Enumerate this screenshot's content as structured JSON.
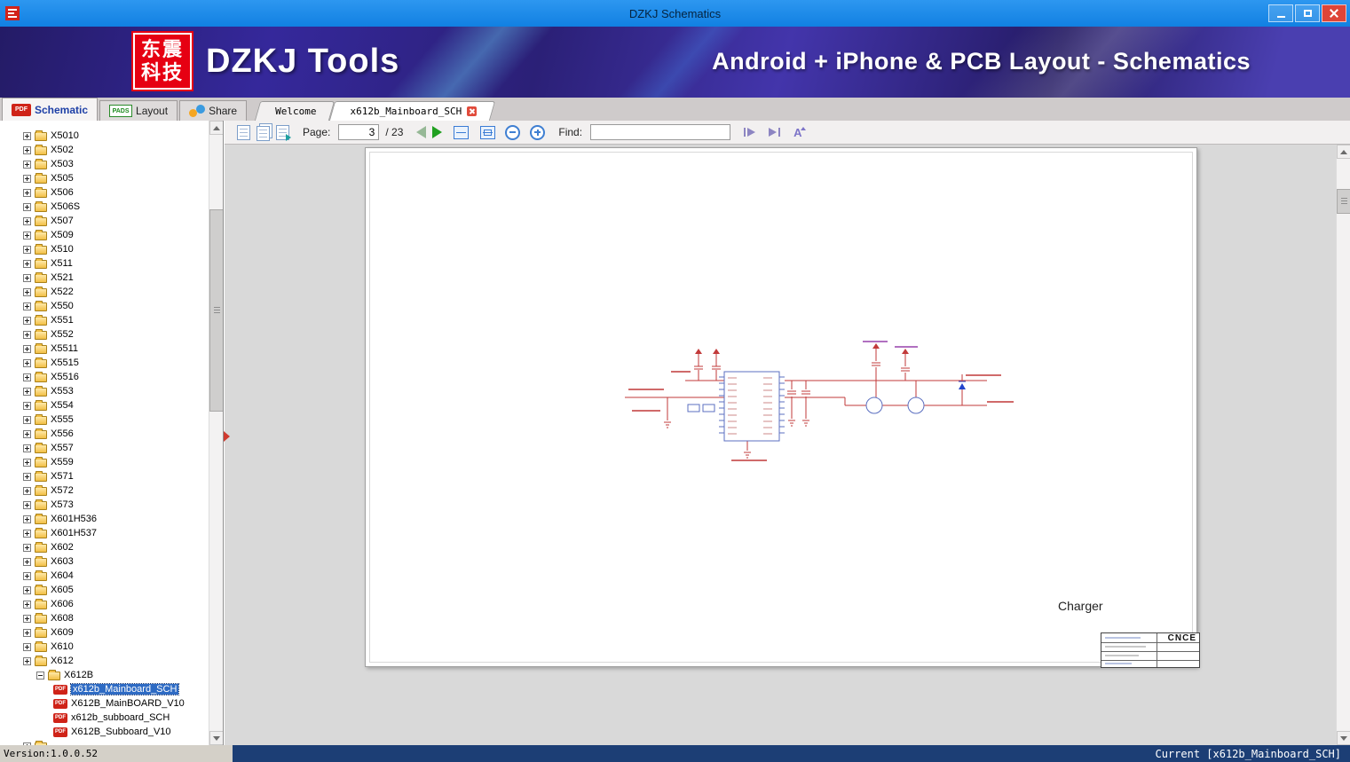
{
  "window": {
    "title": "DZKJ Schematics"
  },
  "banner": {
    "logo_top": "东震",
    "logo_bottom": "科技",
    "app_name": "DZKJ Tools",
    "tagline": "Android + iPhone & PCB Layout - Schematics"
  },
  "mode_tabs": [
    {
      "label": "Schematic",
      "icon_text": "PDF",
      "active": true
    },
    {
      "label": "Layout",
      "icon_text": "PADS",
      "active": false
    },
    {
      "label": "Share",
      "active": false
    }
  ],
  "doc_tabs": [
    {
      "label": "Welcome",
      "active": false
    },
    {
      "label": "x612b_Mainboard_SCH",
      "active": true,
      "closable": true
    }
  ],
  "toolbar": {
    "page_label": "Page:",
    "page_value": "3",
    "page_total": "/ 23",
    "find_label": "Find:",
    "find_value": ""
  },
  "icons": {
    "pdf_text": "PDF",
    "pads_text": "PADS",
    "font_glyph": "A"
  },
  "tree": {
    "folders": [
      "X5010",
      "X502",
      "X503",
      "X505",
      "X506",
      "X506S",
      "X507",
      "X509",
      "X510",
      "X511",
      "X521",
      "X522",
      "X550",
      "X551",
      "X552",
      "X5511",
      "X5515",
      "X5516",
      "X553",
      "X554",
      "X555",
      "X556",
      "X557",
      "X559",
      "X571",
      "X572",
      "X573",
      "X601H536",
      "X601H537",
      "X602",
      "X603",
      "X604",
      "X605",
      "X606",
      "X608",
      "X609",
      "X610",
      "X612"
    ],
    "expanded_folder": "X612B",
    "children": [
      {
        "label": "x612b_Mainboard_SCH",
        "selected": true
      },
      {
        "label": "X612B_MainBOARD_V10",
        "selected": false
      },
      {
        "label": "x612b_subboard_SCH",
        "selected": false
      },
      {
        "label": "X612B_Subboard_V10",
        "selected": false
      }
    ],
    "trailing_partial_label": ""
  },
  "page": {
    "charger_label": "Charger",
    "titleblock_logo": "CNCE"
  },
  "statusbar": {
    "version": "Version:1.0.0.52",
    "current": "Current [x612b_Mainboard_SCH]"
  },
  "colors": {
    "titlebar_blue": "#1789ec",
    "banner_purple": "#35289b",
    "logo_red": "#e60012",
    "selection_blue": "#2e6bc4",
    "status_navy": "#1c3e75",
    "close_red": "#de4538",
    "schematic_red": "#c23a3a",
    "schematic_blue": "#5b6fc0"
  }
}
